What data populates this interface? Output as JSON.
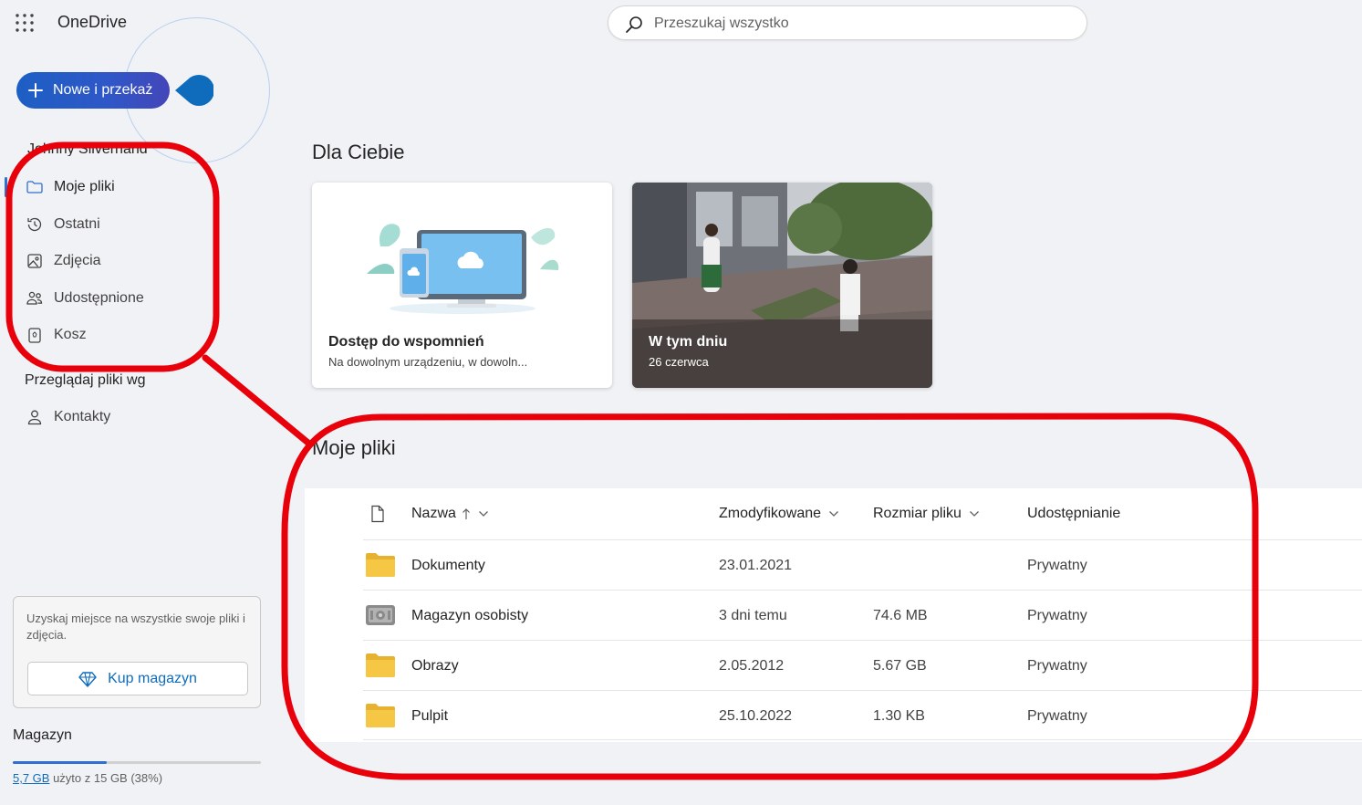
{
  "app": {
    "title": "OneDrive"
  },
  "search": {
    "placeholder": "Przeszukaj wszystko"
  },
  "new_button": {
    "label": "Nowe i przekaż"
  },
  "sidebar": {
    "user_name": "Johnny Silverhand",
    "items": [
      {
        "label": "Moje pliki",
        "icon": "folder-icon",
        "active": true
      },
      {
        "label": "Ostatni",
        "icon": "history-icon"
      },
      {
        "label": "Zdjęcia",
        "icon": "image-icon"
      },
      {
        "label": "Udostępnione",
        "icon": "people-icon"
      },
      {
        "label": "Kosz",
        "icon": "recycle-bin-icon"
      }
    ],
    "browse_title": "Przeglądaj pliki wg",
    "browse_items": [
      {
        "label": "Kontakty",
        "icon": "person-icon"
      }
    ]
  },
  "promo": {
    "text": "Uzyskaj miejsce na wszystkie swoje pliki i zdjęcia.",
    "button_label": "Kup magazyn",
    "button_icon": "diamond-icon"
  },
  "storage": {
    "title": "Magazyn",
    "used": "5,7 GB",
    "rest": " użyto z 15 GB (38%)",
    "percent": 38
  },
  "for_you": {
    "title": "Dla Ciebie",
    "cards": [
      {
        "title": "Dostęp do wspomnień",
        "subtitle": "Na dowolnym urządzeniu, w dowoln..."
      },
      {
        "title": "W tym dniu",
        "subtitle": "26 czerwca"
      }
    ]
  },
  "my_files": {
    "title": "Moje pliki",
    "columns": {
      "name": "Nazwa",
      "modified": "Zmodyfikowane",
      "size": "Rozmiar pliku",
      "sharing": "Udostępnianie"
    },
    "rows": [
      {
        "name": "Dokumenty",
        "modified": "23.01.2021",
        "size": "",
        "sharing": "Prywatny",
        "icon": "folder-icon"
      },
      {
        "name": "Magazyn osobisty",
        "modified": "3 dni temu",
        "size": "74.6 MB",
        "sharing": "Prywatny",
        "icon": "vault-icon"
      },
      {
        "name": "Obrazy",
        "modified": "2.05.2012",
        "size": "5.67 GB",
        "sharing": "Prywatny",
        "icon": "folder-icon"
      },
      {
        "name": "Pulpit",
        "modified": "25.10.2022",
        "size": "1.30 KB",
        "sharing": "Prywatny",
        "icon": "folder-icon"
      }
    ]
  },
  "colors": {
    "accent": "#2f6fd1",
    "annotation": "#e8000b",
    "folder": "#f5c745"
  }
}
